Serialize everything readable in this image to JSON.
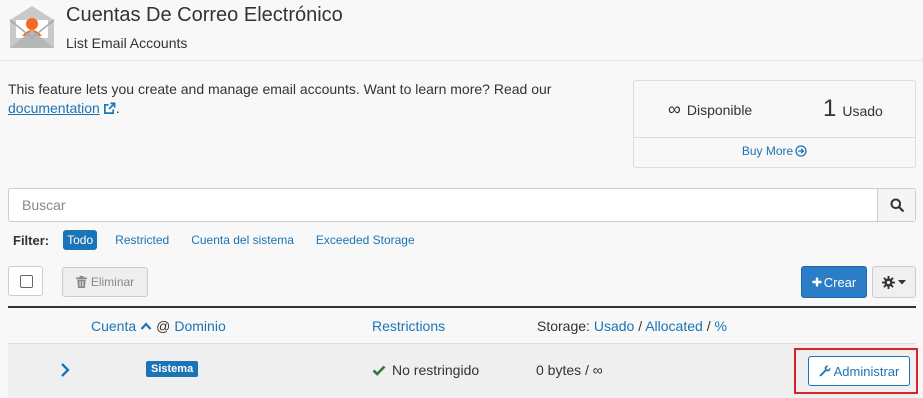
{
  "header": {
    "title": "Cuentas De Correo Electrónico",
    "subtitle": "List Email Accounts"
  },
  "intro": {
    "text": "This feature lets you create and manage email accounts. Want to learn more? Read our",
    "link_label": "documentation",
    "suffix": "."
  },
  "stats": {
    "available_value": "∞",
    "available_label": "Disponible",
    "used_value": "1",
    "used_label": "Usado",
    "buy_more_label": "Buy More"
  },
  "search": {
    "placeholder": "Buscar"
  },
  "filter": {
    "label": "Filter:",
    "items": [
      "Todo",
      "Restricted",
      "Cuenta del sistema",
      "Exceeded Storage"
    ],
    "active": "Todo"
  },
  "toolbar": {
    "delete_label": "Eliminar",
    "create_label": "Crear"
  },
  "table": {
    "headers": {
      "account": "Cuenta",
      "at": "@",
      "domain": "Dominio",
      "restrictions": "Restrictions",
      "storage_prefix": "Storage:",
      "storage_used": "Usado",
      "storage_sep1": "/",
      "storage_allocated": "Allocated",
      "storage_sep2": "/",
      "storage_percent": "%"
    },
    "rows": [
      {
        "badge": "Sistema",
        "restriction": "No restringido",
        "storage": "0 bytes / ∞",
        "action_label": "Administrar"
      }
    ]
  },
  "colors": {
    "accent": "#1b74b5",
    "create_button": "#2a7dc6",
    "success_check": "#3c763d",
    "highlight_box": "#d9232a"
  },
  "icons": {
    "app": "email-account-icon",
    "external": "external-link-icon",
    "buy_more": "arrow-circle-right-icon",
    "search": "search-icon",
    "delete": "trash-icon",
    "create": "plus-icon",
    "settings": "gear-icon",
    "sort": "chevron-up-icon",
    "expand": "chevron-right-icon",
    "check": "check-icon",
    "admin": "wrench-icon"
  }
}
